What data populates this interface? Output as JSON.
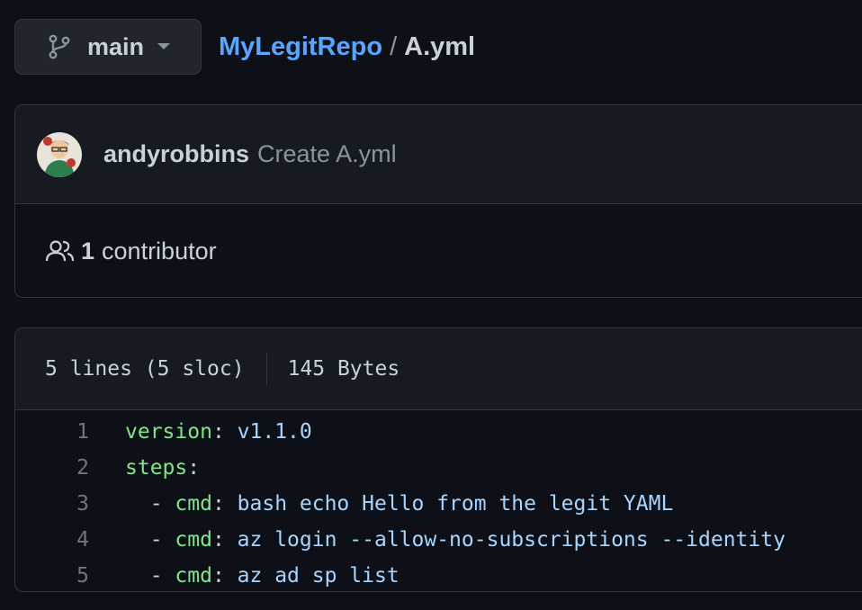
{
  "branch": {
    "name": "main",
    "icon": "git-branch-icon"
  },
  "breadcrumb": {
    "repo": "MyLegitRepo",
    "separator": "/",
    "file": "A.yml"
  },
  "commit": {
    "author": "andyrobbins",
    "message": "Create A.yml",
    "avatar_icon": "avatar"
  },
  "contributors": {
    "count": "1",
    "label": "contributor",
    "icon": "people-icon"
  },
  "file_info": {
    "lines": "5 lines (5 sloc)",
    "size": "145 Bytes"
  },
  "code": {
    "lines": [
      {
        "num": "1",
        "indent": "",
        "dash": "",
        "key": "version",
        "colon": ":",
        "value": " v1.1.0"
      },
      {
        "num": "2",
        "indent": "",
        "dash": "",
        "key": "steps",
        "colon": ":",
        "value": ""
      },
      {
        "num": "3",
        "indent": "  ",
        "dash": "- ",
        "key": "cmd",
        "colon": ":",
        "value": " bash echo Hello from the legit YAML"
      },
      {
        "num": "4",
        "indent": "  ",
        "dash": "- ",
        "key": "cmd",
        "colon": ":",
        "value": " az login --allow-no-subscriptions --identity"
      },
      {
        "num": "5",
        "indent": "  ",
        "dash": "- ",
        "key": "cmd",
        "colon": ":",
        "value": " az ad sp list"
      }
    ]
  },
  "colors": {
    "background": "#0d1117",
    "panel": "#161b22",
    "border": "#30363d",
    "link": "#58a6ff",
    "yaml_key": "#7ee787",
    "yaml_value": "#a5d6ff",
    "line_number": "#6e7681"
  }
}
